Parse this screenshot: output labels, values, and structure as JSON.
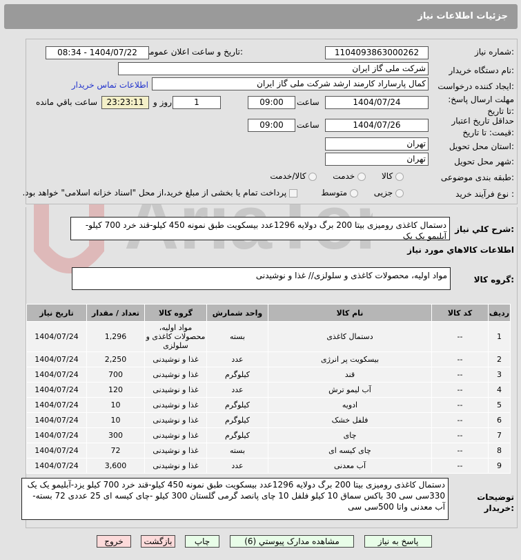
{
  "header": {
    "title": "جزئیات اطلاعات نیاز"
  },
  "form": {
    "need_no_label": "شماره نیاز:",
    "need_no": "1104093863000262",
    "announce_label": "تاریخ و ساعت اعلان عمومی:",
    "announce": "1404/07/22 - 08:34",
    "buyer_label": "نام دستگاه خریدار:",
    "buyer": "شرکت ملی گاز ایران",
    "creator_label": "ایجاد کننده درخواست:",
    "creator": "کمال پارساراد کارمند ارشد شرکت ملی گاز ایران",
    "contact_link": "اطلاعات تماس خریدار",
    "deadline_label": "مهلت ارسال پاسخ: تا تاریخ:",
    "deadline_date": "1404/07/24",
    "time_label": "ساعت",
    "deadline_time": "09:00",
    "days": "1",
    "days_label": "روز و",
    "remaining": "23:23:11",
    "remaining_label": "ساعت باقي مانده",
    "validity_label": "حداقل تاریخ اعتبار قیمت: تا تاریخ:",
    "validity_date": "1404/07/26",
    "validity_time": "09:00",
    "province_label": "استان محل تحویل:",
    "province": "تهران",
    "city_label": "شهر محل تحویل:",
    "city": "تهران",
    "category_label": "طبقه بندی موضوعی:",
    "category_options": [
      "کالا",
      "خدمت",
      "کالا/خدمت"
    ],
    "process_label": "نوع فرآیند خرید :",
    "process_options": [
      "جزیی",
      "متوسط"
    ],
    "payment_note": "پرداخت تمام یا بخشی از مبلغ خرید،از محل \"اسناد خزانه اسلامی\" خواهد بود."
  },
  "summary": {
    "label": "شرح کلي نیاز:",
    "text": "دستمال کاغذی رومیزی بیتا 200 برگ دولایه 1296عدد بیسکویت طبق نمونه 450 کیلو-قند خرد 700 کیلو-آبلیمو یک یک"
  },
  "goods": {
    "title": "اطلاعات کالاهاي مورد نیاز",
    "group_label": "گروه کالا:",
    "group": "مواد اولیه، محصولات کاغذی و سلولزی// غذا و نوشیدنی"
  },
  "table": {
    "headers": [
      "ردیف",
      "کد کالا",
      "نام کالا",
      "واحد شمارش",
      "گروه کالا",
      "تعداد / مقدار",
      "تاریخ نیاز"
    ],
    "rows": [
      [
        "1",
        "--",
        "دستمال کاغذی",
        "بسته",
        "مواد اولیه، محصولات کاغذی و سلولزی",
        "1,296",
        "1404/07/24"
      ],
      [
        "2",
        "--",
        "بیسکویت پر انرژی",
        "عدد",
        "غذا و نوشیدنی",
        "2,250",
        "1404/07/24"
      ],
      [
        "3",
        "--",
        "قند",
        "کیلوگرم",
        "غذا و نوشیدنی",
        "700",
        "1404/07/24"
      ],
      [
        "4",
        "--",
        "آب لیمو ترش",
        "عدد",
        "غذا و نوشیدنی",
        "120",
        "1404/07/24"
      ],
      [
        "5",
        "--",
        "ادویه",
        "کیلوگرم",
        "غذا و نوشیدنی",
        "10",
        "1404/07/24"
      ],
      [
        "6",
        "--",
        "فلفل خشک",
        "کیلوگرم",
        "غذا و نوشیدنی",
        "10",
        "1404/07/24"
      ],
      [
        "7",
        "--",
        "چای",
        "کیلوگرم",
        "غذا و نوشیدنی",
        "300",
        "1404/07/24"
      ],
      [
        "8",
        "--",
        "چای کیسه ای",
        "بسته",
        "غذا و نوشیدنی",
        "72",
        "1404/07/24"
      ],
      [
        "9",
        "--",
        "آب معدنی",
        "عدد",
        "غذا و نوشیدنی",
        "3,600",
        "1404/07/24"
      ]
    ]
  },
  "notes": {
    "label": "توضیحات خریدار:",
    "text": "دستمال کاغذی رومیزی بیتا 200 برگ دولایه 1296عدد بیسکویت طبق نمونه 450 کیلو-قند خرد 700 کیلو یزد-آبلیمو یک یک 330سی سی 30 باکس سماق 10 کیلو فلفل 10 چای پانصد گرمی گلستان 300 کیلو -چای کیسه ای 25 عددی 72 بسته-آب معدنی واتا 500سی سی"
  },
  "buttons": {
    "reply": "پاسخ به نیاز",
    "attachments": "مشاهده مدارک پیوستي (6)",
    "print": "چاپ",
    "back": "بازگشت",
    "exit": "خروج"
  },
  "colors": {
    "header": "#9a9a9a",
    "green_button": "#e8fde8",
    "red_button": "#fcdada",
    "link": "#2233cc"
  }
}
